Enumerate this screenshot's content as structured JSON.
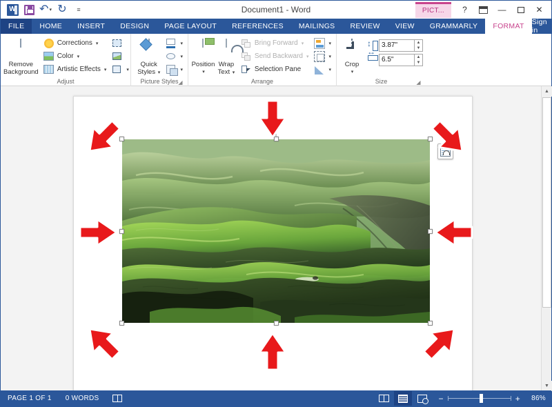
{
  "titlebar": {
    "document_title": "Document1 - Word",
    "qat": [
      {
        "name": "word-logo",
        "label": "W"
      },
      {
        "name": "save-icon",
        "label": "Save"
      },
      {
        "name": "undo-icon",
        "label": "Undo"
      },
      {
        "name": "redo-icon",
        "label": "Redo"
      },
      {
        "name": "customize-qat-icon",
        "label": "Customize Quick Access Toolbar"
      }
    ],
    "contextual_tab_label": "PICT...",
    "help_label": "?",
    "ribbon_display_label": "Ribbon Display Options",
    "minimize_label": "—",
    "restore_label": "❐",
    "close_label": "✕"
  },
  "tabs": [
    {
      "label": "FILE",
      "active": false
    },
    {
      "label": "HOME",
      "active": false
    },
    {
      "label": "INSERT",
      "active": false
    },
    {
      "label": "DESIGN",
      "active": false
    },
    {
      "label": "PAGE LAYOUT",
      "active": false
    },
    {
      "label": "REFERENCES",
      "active": false
    },
    {
      "label": "MAILINGS",
      "active": false
    },
    {
      "label": "REVIEW",
      "active": false
    },
    {
      "label": "VIEW",
      "active": false
    },
    {
      "label": "GRAMMARLY",
      "active": false
    },
    {
      "label": "FORMAT",
      "active": true
    }
  ],
  "signin_label": "Sign in",
  "ribbon": {
    "groups": [
      {
        "name": "adjust",
        "label": "Adjust",
        "big_button": "Remove\nBackground",
        "big_button_line1": "Remove",
        "big_button_line2": "Background",
        "items": [
          {
            "label": "Corrections",
            "icon": "brightness-icon",
            "has_dropdown": true
          },
          {
            "label": "Color",
            "icon": "color-icon",
            "has_dropdown": true
          },
          {
            "label": "Artistic Effects",
            "icon": "artistic-effects-icon",
            "has_dropdown": true
          }
        ],
        "right_items": [
          {
            "label": "",
            "icon": "compress-pictures-icon"
          },
          {
            "label": "",
            "icon": "change-picture-icon"
          },
          {
            "label": "",
            "icon": "reset-picture-icon",
            "has_dropdown": true
          }
        ]
      },
      {
        "name": "picture-styles",
        "label": "Picture Styles",
        "big_button_line1": "Quick",
        "big_button_line2": "Styles",
        "right_items": [
          {
            "label": "",
            "icon": "picture-border-icon",
            "has_dropdown": true
          },
          {
            "label": "",
            "icon": "picture-effects-icon",
            "has_dropdown": true
          },
          {
            "label": "",
            "icon": "picture-layout-icon",
            "has_dropdown": true
          }
        ],
        "has_dialog_launcher": true
      },
      {
        "name": "arrange",
        "label": "Arrange",
        "big_buttons": [
          {
            "line1": "Position",
            "line2": "",
            "icon": "position-icon",
            "has_dropdown": true
          },
          {
            "line1": "Wrap",
            "line2": "Text",
            "icon": "wrap-text-icon",
            "has_dropdown": true
          }
        ],
        "items": [
          {
            "label": "Bring Forward",
            "icon": "bring-forward-icon",
            "disabled": true,
            "has_dropdown": true
          },
          {
            "label": "Send Backward",
            "icon": "send-backward-icon",
            "disabled": true,
            "has_dropdown": true
          },
          {
            "label": "Selection Pane",
            "icon": "selection-pane-icon",
            "disabled": false
          }
        ],
        "right_items": [
          {
            "label": "",
            "icon": "align-icon",
            "has_dropdown": true
          },
          {
            "label": "",
            "icon": "group-icon",
            "has_dropdown": true
          },
          {
            "label": "",
            "icon": "rotate-icon",
            "has_dropdown": true
          }
        ]
      },
      {
        "name": "size",
        "label": "Size",
        "big_button_line1": "Crop",
        "fields": [
          {
            "name": "shape-height",
            "icon": "height-icon",
            "value": "3.87\"",
            "placeholder": "0\""
          },
          {
            "name": "shape-width",
            "icon": "width-icon",
            "value": "6.5\"",
            "placeholder": "0\""
          }
        ],
        "has_dialog_launcher": true
      }
    ]
  },
  "document": {
    "page_label": "page-1",
    "image": {
      "alt": "aerial photograph of rolling green hills",
      "selected": true,
      "handles": [
        "top-left",
        "top-center",
        "top-right",
        "middle-left",
        "middle-right",
        "bottom-left",
        "bottom-center",
        "bottom-right"
      ],
      "rotation_handle": true,
      "layout_options_label": "Layout Options"
    },
    "annotation_arrows": {
      "count": 8,
      "color": "#E8191B",
      "outline_color": "#ffffff",
      "targets": [
        "top-left-handle",
        "top-center-handle",
        "top-right-handle",
        "middle-left-handle",
        "middle-right-handle",
        "bottom-left-handle",
        "bottom-center-handle",
        "bottom-right-handle"
      ]
    }
  },
  "statusbar": {
    "page_count": "PAGE 1 OF 1",
    "word_count": "0 WORDS",
    "proofing_icon": "proofing-errors-icon",
    "views": [
      {
        "name": "read-mode",
        "label": "Read Mode",
        "selected": false
      },
      {
        "name": "print-layout",
        "label": "Print Layout",
        "selected": true
      },
      {
        "name": "web-layout",
        "label": "Web Layout",
        "selected": false
      }
    ],
    "zoom_out_label": "−",
    "zoom_in_label": "+",
    "zoom_level": "86%"
  },
  "colors": {
    "word_blue": "#2b579a",
    "word_blue_dark": "#1e4384",
    "contextual_pink": "#c8438c",
    "arrow_red": "#E8191B",
    "page_bg": "#f3f3f3"
  }
}
